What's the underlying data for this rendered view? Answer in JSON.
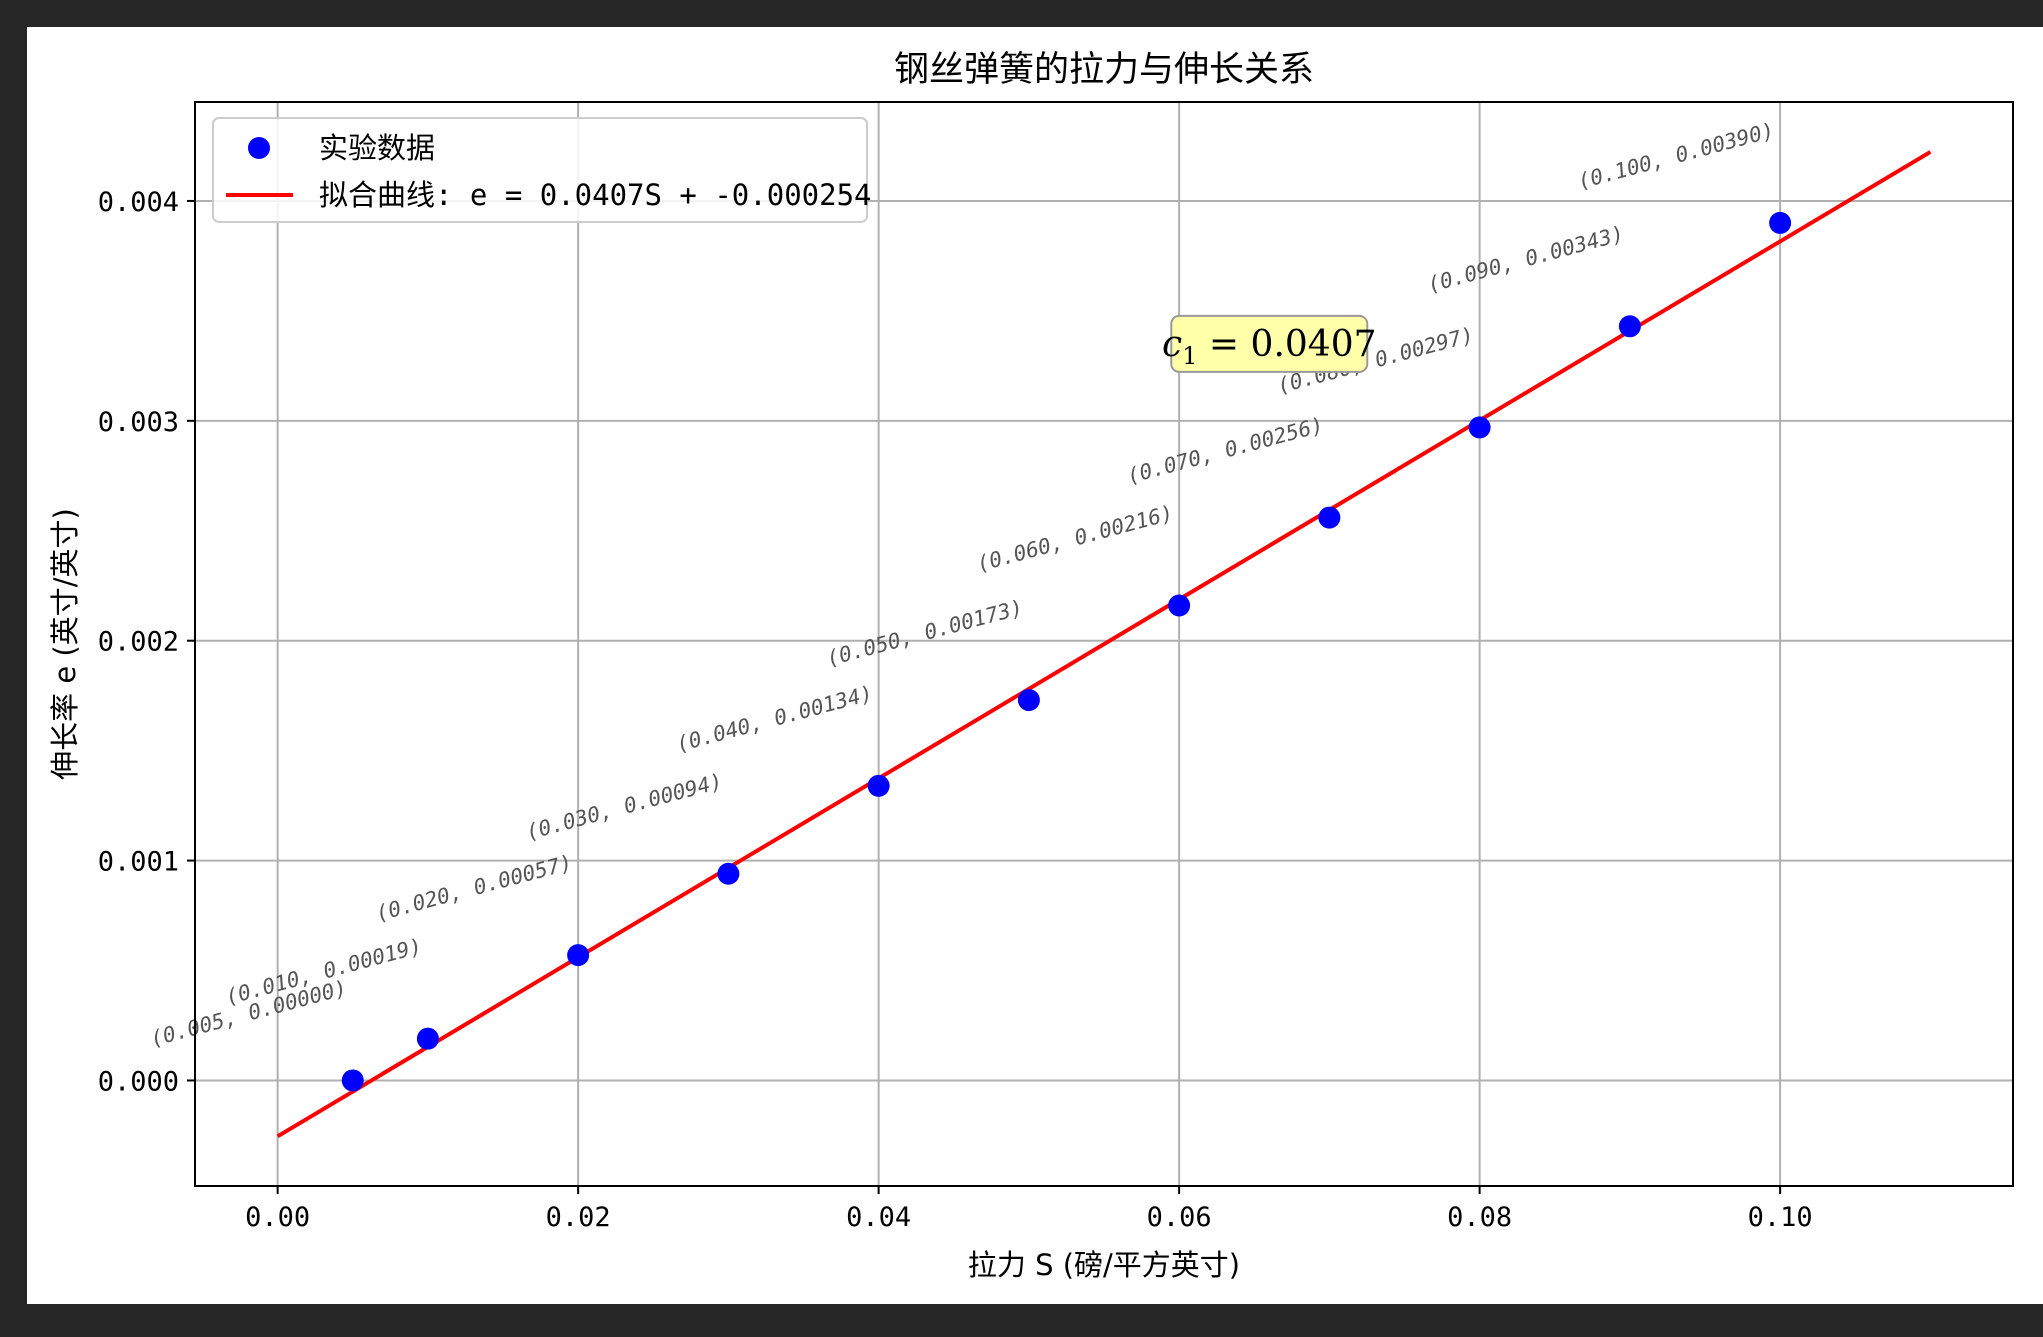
{
  "chart_data": {
    "type": "scatter",
    "title": "钢丝弹簧的拉力与伸长关系",
    "xlabel": "拉力 S (磅/平方英寸)",
    "ylabel": "伸长率 e (英寸/英寸)",
    "xlim": [
      -0.0055,
      0.1155
    ],
    "ylim": [
      -0.00048,
      0.00445
    ],
    "xticks": [
      0.0,
      0.02,
      0.04,
      0.06,
      0.08,
      0.1
    ],
    "xtick_labels": [
      "0.00",
      "0.02",
      "0.04",
      "0.06",
      "0.08",
      "0.10"
    ],
    "yticks": [
      0.0,
      0.001,
      0.002,
      0.003,
      0.004
    ],
    "ytick_labels": [
      "0.000",
      "0.001",
      "0.002",
      "0.003",
      "0.004"
    ],
    "grid": true,
    "legend_position": "top-left",
    "series": [
      {
        "name": "实验数据",
        "kind": "scatter",
        "color": "#0000ff",
        "x": [
          0.005,
          0.01,
          0.02,
          0.03,
          0.04,
          0.05,
          0.06,
          0.07,
          0.08,
          0.09,
          0.1
        ],
        "y": [
          0.0,
          0.00019,
          0.00057,
          0.00094,
          0.00134,
          0.00173,
          0.00216,
          0.00256,
          0.00297,
          0.00343,
          0.0039
        ],
        "point_labels": [
          "(0.005, 0.00000)",
          "(0.010, 0.00019)",
          "(0.020, 0.00057)",
          "(0.030, 0.00094)",
          "(0.040, 0.00134)",
          "(0.050, 0.00173)",
          "(0.060, 0.00216)",
          "(0.070, 0.00256)",
          "(0.080, 0.00297)",
          "(0.090, 0.00343)",
          "(0.100, 0.00390)"
        ]
      },
      {
        "name": "拟合曲线: e = 0.0407S + -0.000254",
        "kind": "line",
        "color": "#ff0000",
        "x": [
          0.0,
          0.11
        ],
        "y": [
          -0.000254,
          0.004223
        ]
      }
    ],
    "annotation": {
      "text_c": "c",
      "text_sub": "1",
      "text_rest": " = 0.0407",
      "x": 0.066,
      "y": 0.00335,
      "box_fill": "#ffffaa",
      "box_edge": "#999999"
    }
  }
}
